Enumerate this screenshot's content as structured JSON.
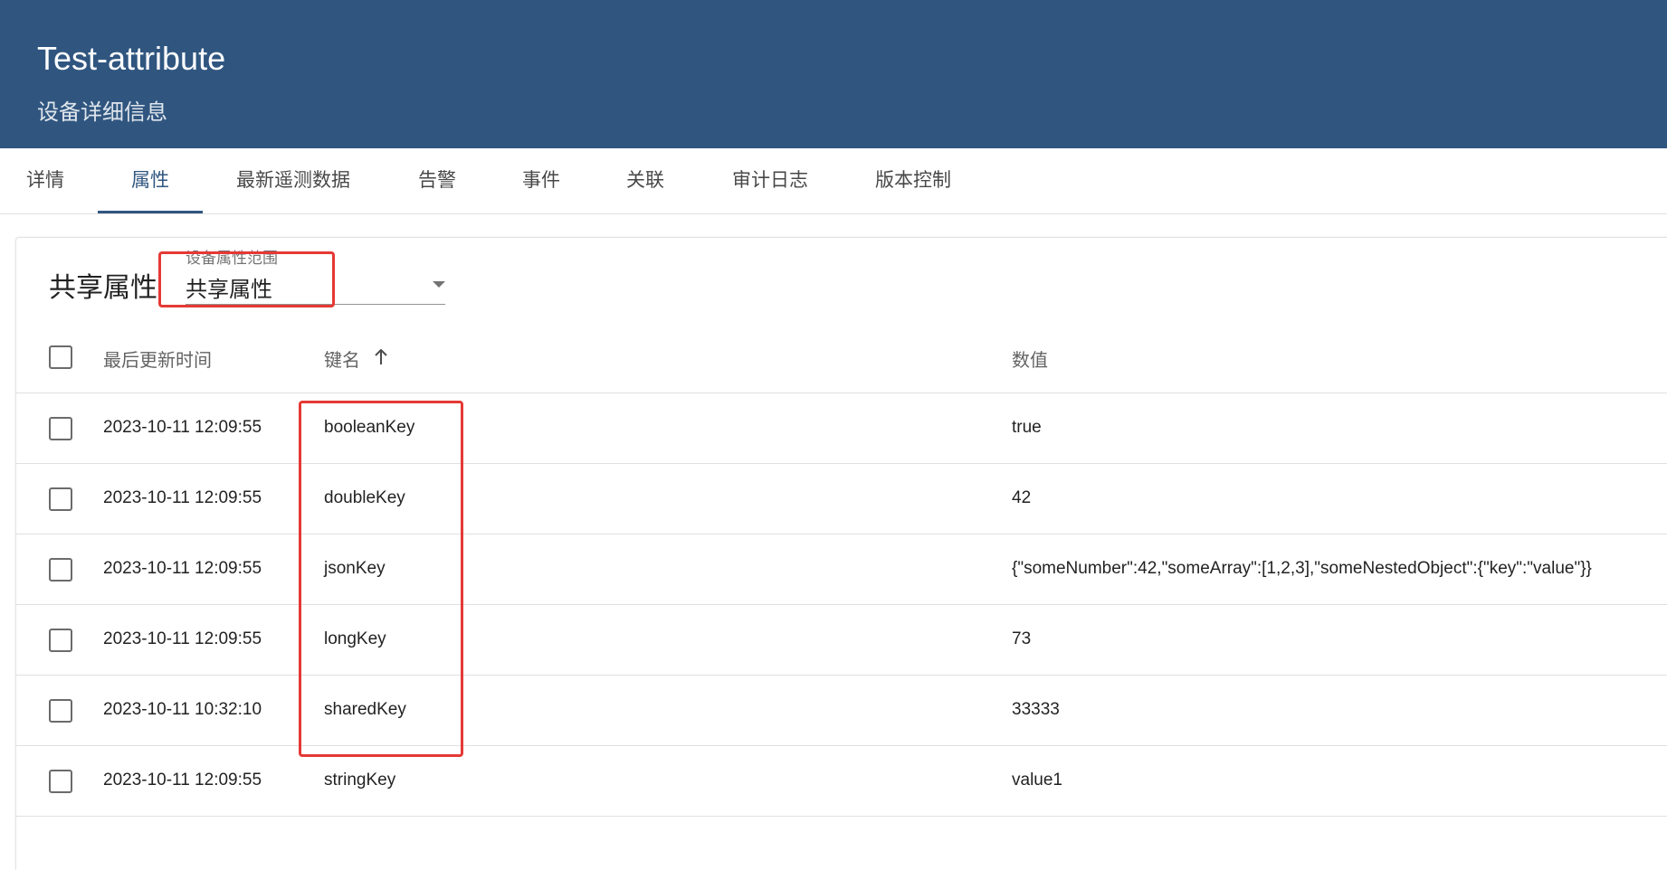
{
  "header": {
    "title": "Test-attribute",
    "subtitle": "设备详细信息"
  },
  "tabs": [
    {
      "label": "详情"
    },
    {
      "label": "属性"
    },
    {
      "label": "最新遥测数据"
    },
    {
      "label": "告警"
    },
    {
      "label": "事件"
    },
    {
      "label": "关联"
    },
    {
      "label": "审计日志"
    },
    {
      "label": "版本控制"
    }
  ],
  "active_tab": "属性",
  "card": {
    "title": "共享属性",
    "scope_select": {
      "label": "设备属性范围",
      "value": "共享属性"
    }
  },
  "table": {
    "columns": {
      "time": "最后更新时间",
      "key": "键名",
      "value": "数值"
    },
    "sort": {
      "column": "key",
      "direction": "asc",
      "icon": "arrow-up-icon"
    },
    "rows": [
      {
        "time": "2023-10-11 12:09:55",
        "key": "booleanKey",
        "value": "true"
      },
      {
        "time": "2023-10-11 12:09:55",
        "key": "doubleKey",
        "value": "42"
      },
      {
        "time": "2023-10-11 12:09:55",
        "key": "jsonKey",
        "value": "{\"someNumber\":42,\"someArray\":[1,2,3],\"someNestedObject\":{\"key\":\"value\"}}"
      },
      {
        "time": "2023-10-11 12:09:55",
        "key": "longKey",
        "value": "73"
      },
      {
        "time": "2023-10-11 10:32:10",
        "key": "sharedKey",
        "value": "33333"
      },
      {
        "time": "2023-10-11 12:09:55",
        "key": "stringKey",
        "value": "value1"
      }
    ]
  },
  "colors": {
    "header_bg": "#305680",
    "accent": "#305680",
    "highlight": "#e53935"
  }
}
